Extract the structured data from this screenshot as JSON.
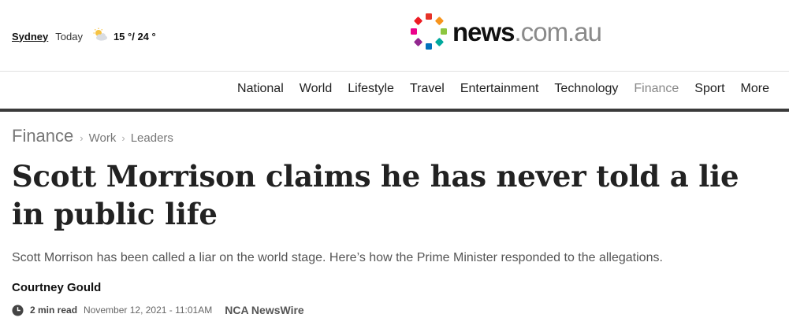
{
  "weather": {
    "city": "Sydney",
    "day": "Today",
    "icon": "partly-cloudy-icon",
    "temps": "15 °/ 24 °"
  },
  "logo": {
    "word_main": "news",
    "word_domain": ".com.au",
    "dot_colors": [
      "#e63228",
      "#f7941d",
      "#8dc63f",
      "#00a99d",
      "#0072bc",
      "#92278f",
      "#ec008c",
      "#ed1c24"
    ]
  },
  "nav": {
    "items": [
      "National",
      "World",
      "Lifestyle",
      "Travel",
      "Entertainment",
      "Technology",
      "Finance",
      "Sport",
      "More"
    ],
    "active": "Finance"
  },
  "breadcrumb": {
    "section": "Finance",
    "sub": [
      "Work",
      "Leaders"
    ]
  },
  "article": {
    "headline": "Scott Morrison claims he has never told a lie in public life",
    "standfirst": "Scott Morrison has been called a liar on the world stage. Here’s how the Prime Minister responded to the allegations.",
    "author": "Courtney Gould",
    "read_time": "2 min read",
    "date": "November 12, 2021 - 11:01AM",
    "source": "NCA NewsWire"
  }
}
